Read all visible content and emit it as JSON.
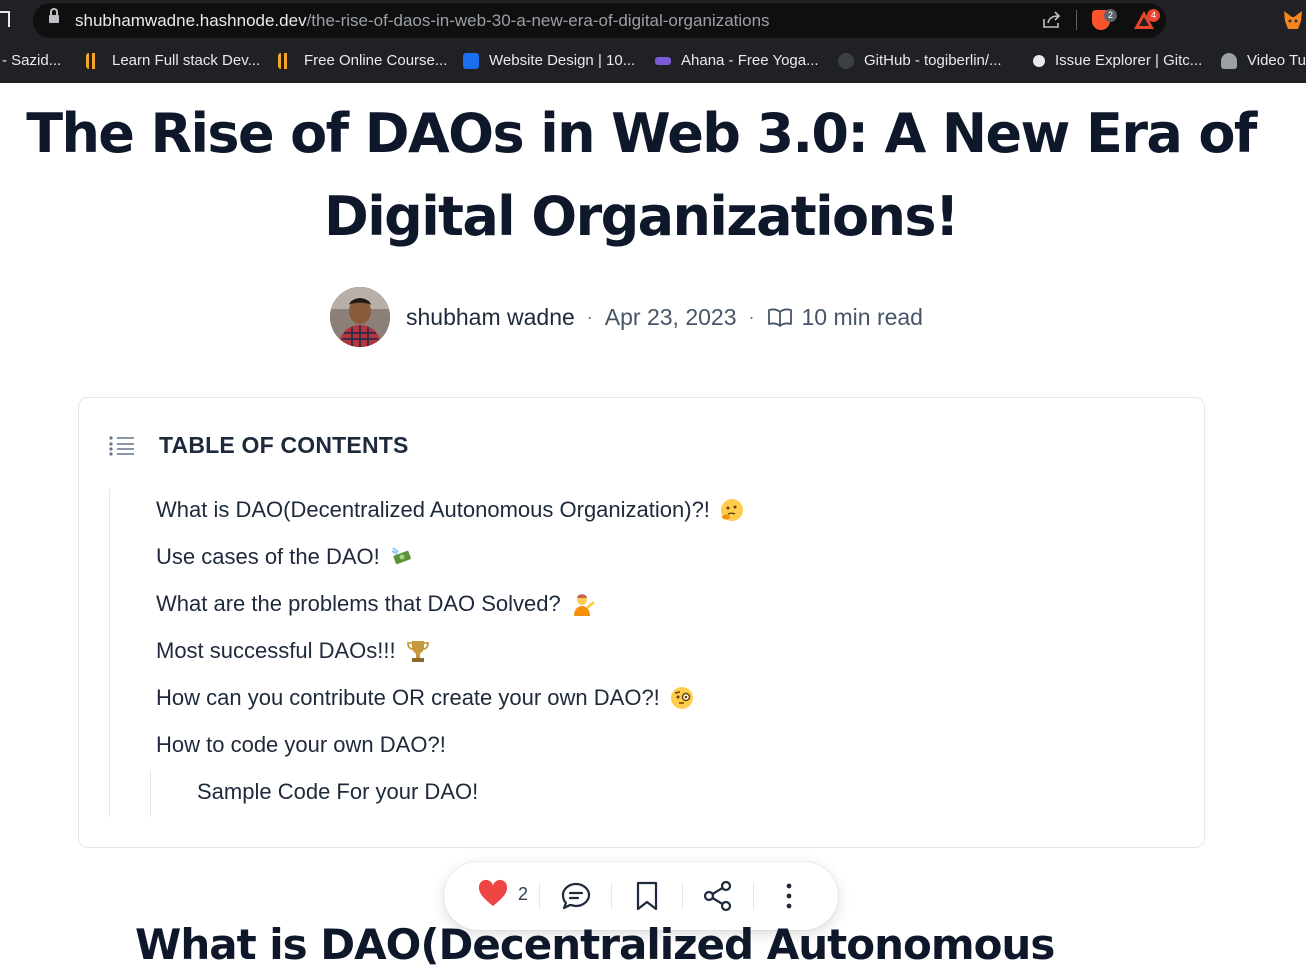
{
  "browser": {
    "url_domain": "shubhamwadne.hashnode.dev",
    "url_path": "/the-rise-of-daos-in-web-30-a-new-era-of-digital-organizations",
    "brave_badge": "2",
    "rewards_badge": "4"
  },
  "bookmarks": [
    {
      "label": "- Sazid...",
      "icon": "bookmark-icon"
    },
    {
      "label": "Learn Full stack Dev...",
      "icon": "bookmark-icon"
    },
    {
      "label": "Free Online Course...",
      "icon": "bookmark-icon"
    },
    {
      "label": "Website Design | 10...",
      "icon": "bookmark-icon"
    },
    {
      "label": "Ahana - Free Yoga...",
      "icon": "bookmark-icon"
    },
    {
      "label": "GitHub - togiberlin/...",
      "icon": "github-icon"
    },
    {
      "label": "Issue Explorer | Gitc...",
      "icon": "bookmark-icon"
    },
    {
      "label": "Video Tu",
      "icon": "bookmark-icon"
    }
  ],
  "article": {
    "title_line1": "The Rise of DAOs in Web 3.0: A New Era of",
    "title_line2": "Digital Organizations!",
    "author": "shubham wadne",
    "date": "Apr 23, 2023",
    "read_time": "10 min read"
  },
  "toc": {
    "heading": "TABLE OF CONTENTS",
    "items": [
      {
        "label": "What is DAO(Decentralized Autonomous Organization)?!",
        "emoji": "thinking-face"
      },
      {
        "label": "Use cases of the DAO!",
        "emoji": "money-with-wings"
      },
      {
        "label": "What are the problems that DAO Solved?",
        "emoji": "person-tipping-hand"
      },
      {
        "label": "Most successful DAOs!!!",
        "emoji": "trophy"
      },
      {
        "label": "How can you contribute OR create your own DAO?!",
        "emoji": "face-with-monocle"
      },
      {
        "label": "How to code your own DAO?!",
        "emoji": ""
      },
      {
        "label": "Sample Code For your DAO!",
        "emoji": ""
      }
    ]
  },
  "actions": {
    "like_count": "2"
  },
  "section": {
    "heading": "What is DAO(Decentralized Autonomous"
  },
  "colors": {
    "text_primary": "#0f172a",
    "heart": "#ef4444",
    "border": "#e2e8f0"
  }
}
